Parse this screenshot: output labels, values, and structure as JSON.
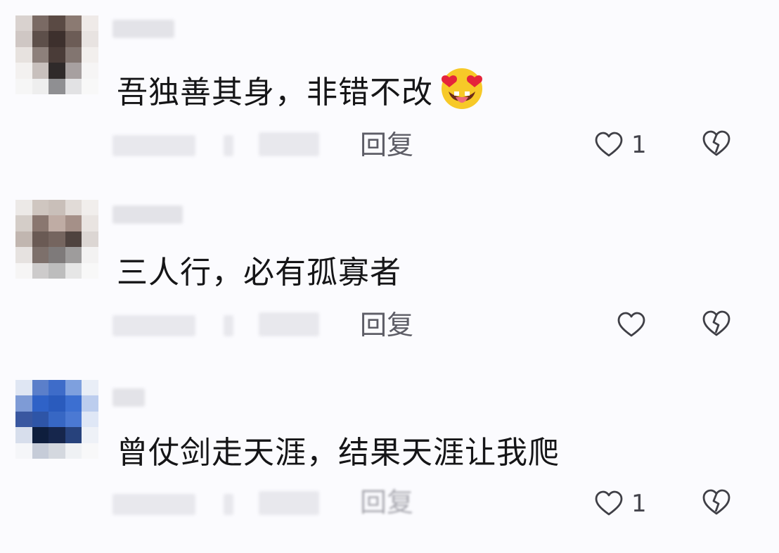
{
  "comments": [
    {
      "text": "吾独善其身，非错不改",
      "emoji": "star-struck-tongue-emoji",
      "reply_label": "回复",
      "like_count": "1",
      "avatar_colors": [
        "#d9d2cf",
        "#7a6a64",
        "#5a4a44",
        "#8b7a72",
        "#efeae8",
        "#cfc7c4",
        "#5d4f4a",
        "#3d302d",
        "#6c5c56",
        "#e8e3e1",
        "#e7e2df",
        "#8d807b",
        "#4a3c38",
        "#827570",
        "#f2efed",
        "#f3f1f0",
        "#c8c0bd",
        "#2f2a2a",
        "#a7a0a0",
        "#f6f5f5",
        "#f6f6f6",
        "#eeeeee",
        "#8f8f92",
        "#e2e2e4",
        "#f8f8f8"
      ]
    },
    {
      "text": "三人行，必有孤寡者",
      "reply_label": "回复",
      "like_count": "",
      "avatar_colors": [
        "#ece9e7",
        "#cfc6c0",
        "#c9bfb9",
        "#e1dbd7",
        "#f1eeec",
        "#d4cdc8",
        "#8a7770",
        "#bfaca4",
        "#a59088",
        "#e9e4e1",
        "#c1b6b0",
        "#6a5a54",
        "#75655f",
        "#4f433f",
        "#dcd6d3",
        "#e6e2e0",
        "#7d706b",
        "#7e7a7a",
        "#9e9c9c",
        "#f3f2f2",
        "#f6f5f5",
        "#cdcbcb",
        "#bdbdbd",
        "#e6e6e6",
        "#f8f8f8"
      ]
    },
    {
      "text": "曾仗剑走天涯，结果天涯让我爬",
      "reply_label": "回复",
      "like_count": "1",
      "avatar_colors": [
        "#dfe6f3",
        "#5b7fca",
        "#3e6cc9",
        "#7ea0de",
        "#e9eef7",
        "#7e9bd6",
        "#2f62c7",
        "#2a5bbd",
        "#3c6fd1",
        "#bccdee",
        "#3957a0",
        "#2e55a7",
        "#3767c4",
        "#4b79d3",
        "#dfe7f6",
        "#d7deec",
        "#0e1e3d",
        "#16264c",
        "#27427c",
        "#eef1f7",
        "#f5f6f9",
        "#c6ccd8",
        "#d4d8df",
        "#eff1f4",
        "#f8f8f9"
      ]
    }
  ]
}
